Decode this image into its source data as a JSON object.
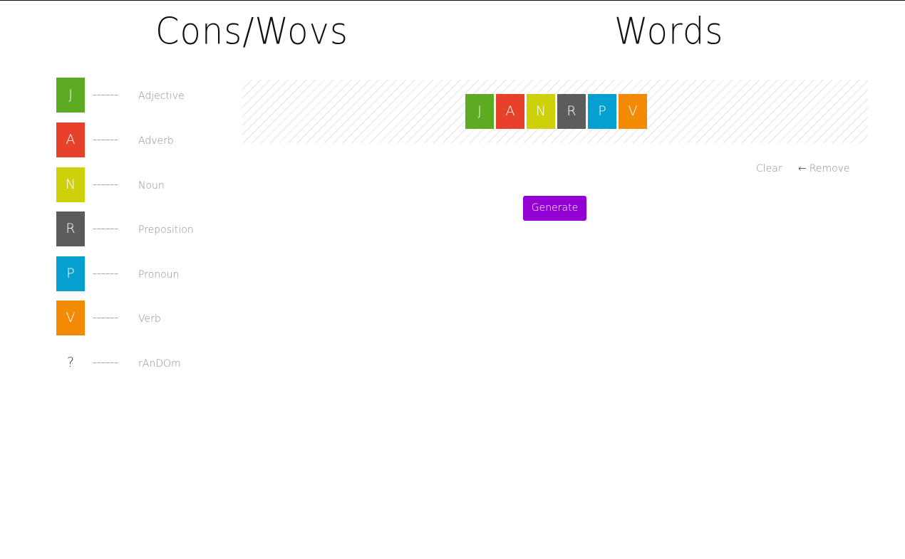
{
  "headings": {
    "left": "Cons/Wovs",
    "right": "Words"
  },
  "legend": {
    "dash": "––––––",
    "items": [
      {
        "letter": "J",
        "label": "Adjective",
        "color": "#5daa23"
      },
      {
        "letter": "A",
        "label": "Adverb",
        "color": "#e8412b"
      },
      {
        "letter": "N",
        "label": "Noun",
        "color": "#cdd10a"
      },
      {
        "letter": "R",
        "label": "Preposition",
        "color": "#5c5c5c"
      },
      {
        "letter": "P",
        "label": "Pronoun",
        "color": "#05a0cf"
      },
      {
        "letter": "V",
        "label": "Verb",
        "color": "#f28a06"
      },
      {
        "letter": "?",
        "label": "rAnDOm",
        "color": "transparent"
      }
    ]
  },
  "word": {
    "tiles": [
      {
        "letter": "J",
        "color": "#5daa23"
      },
      {
        "letter": "A",
        "color": "#e8412b"
      },
      {
        "letter": "N",
        "color": "#cdd10a"
      },
      {
        "letter": "R",
        "color": "#5c5c5c"
      },
      {
        "letter": "P",
        "color": "#05a0cf"
      },
      {
        "letter": "V",
        "color": "#f28a06"
      }
    ]
  },
  "actions": {
    "clear_label": "Clear",
    "remove_arrow": "←",
    "remove_label": "Remove",
    "generate_label": "Generate"
  }
}
